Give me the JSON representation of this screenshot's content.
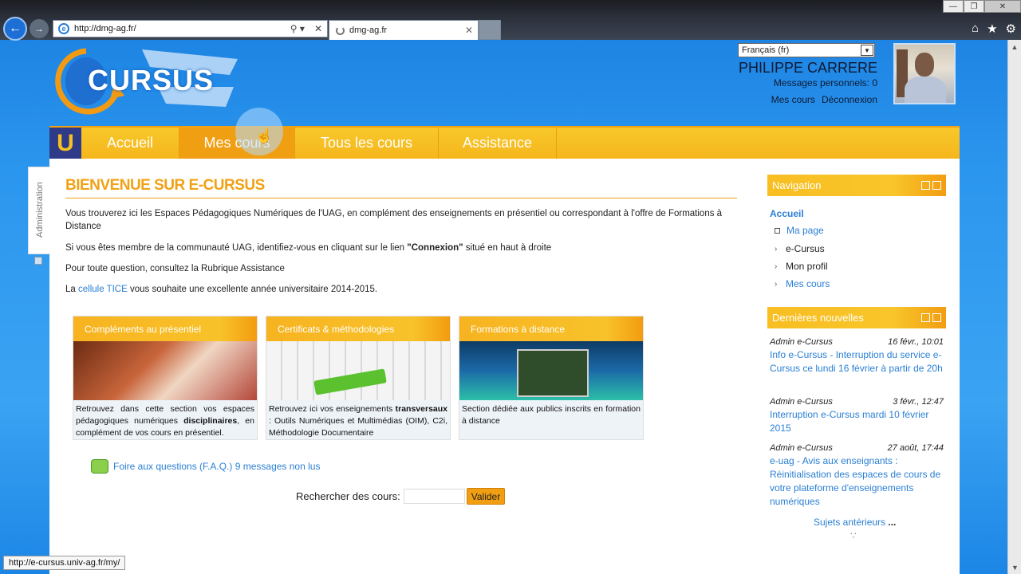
{
  "browser": {
    "url": "http://dmg-ag.fr/",
    "tab_title": "dmg-ag.fr",
    "status_url": "http://e-cursus.univ-ag.fr/my/"
  },
  "header": {
    "logo_text": "CURSUS",
    "language": "Français (fr)",
    "user_name": "PHILIPPE CARRERE",
    "messages": "Messages personnels: 0",
    "my_courses": "Mes cours",
    "logout": "Déconnexion"
  },
  "menu": {
    "logo": "U",
    "items": [
      "Accueil",
      "Mes cours",
      "Tous les cours",
      "Assistance"
    ]
  },
  "admin_tab": "Administration",
  "main": {
    "title": "BIENVENUE SUR E-CURSUS",
    "p1": "Vous trouverez ici les Espaces Pédagogiques Numériques de l'UAG, en complément des enseignements en présentiel ou correspondant à l'offre de Formations à Distance",
    "p2_before": "Si vous êtes membre de la communauté UAG, identifiez-vous en cliquant sur le lien ",
    "p2_bold": "\"Connexion\"",
    "p2_after": " situé en haut à droite",
    "p3": "Pour toute question, consultez la Rubrique Assistance",
    "p4_before": "La ",
    "p4_link": "cellule TICE",
    "p4_after": " vous souhaite une excellente année universitaire 2014-2015.",
    "cards": [
      {
        "title": "Compléments au présentiel",
        "d1": "Retrouvez dans cette section vos espaces pédagogiques numériques ",
        "d_bold": "disciplinaires",
        "d2": ", en complément de vos cours en présentiel."
      },
      {
        "title": "Certificats & méthodologies",
        "d1": "Retrouvez ici vos enseignements ",
        "d_bold": "transversaux",
        "d2": " : Outils Numériques et Multimédias (OIM), C2i, Méthodologie Documentaire"
      },
      {
        "title": "Formations à distance",
        "d1": "Section dédiée aux publics inscrits en formation à distance",
        "d_bold": "",
        "d2": ""
      }
    ],
    "faq": "Foire aux questions (F.A.Q.) 9 messages non lus",
    "search_label": "Rechercher des cours:",
    "search_value": "",
    "search_button": "Valider"
  },
  "navigation": {
    "title": "Navigation",
    "home": "Accueil",
    "items": [
      "Ma page",
      "e-Cursus",
      "Mon profil",
      "Mes cours"
    ]
  },
  "news": {
    "title": "Dernières nouvelles",
    "items": [
      {
        "author": "Admin e-Cursus",
        "date": "16 févr., 10:01",
        "text": "Info e-Cursus - Interruption du service e-Cursus ce lundi 16 février à partir de 20h"
      },
      {
        "author": "Admin e-Cursus",
        "date": "3 févr., 12:47",
        "text": "Interruption e-Cursus mardi 10 février 2015"
      },
      {
        "author": "Admin e-Cursus",
        "date": "27 août, 17:44",
        "text": "e-uag - Avis aux enseignants : Réinitialisation des espaces de cours de votre plateforme d'enseignements numériques"
      }
    ],
    "older": "Sujets antérieurs",
    "older_suffix": "..."
  },
  "colors": {
    "accent": "#f0a216",
    "menu": "#f8c82a",
    "link": "#2a7fd4"
  }
}
